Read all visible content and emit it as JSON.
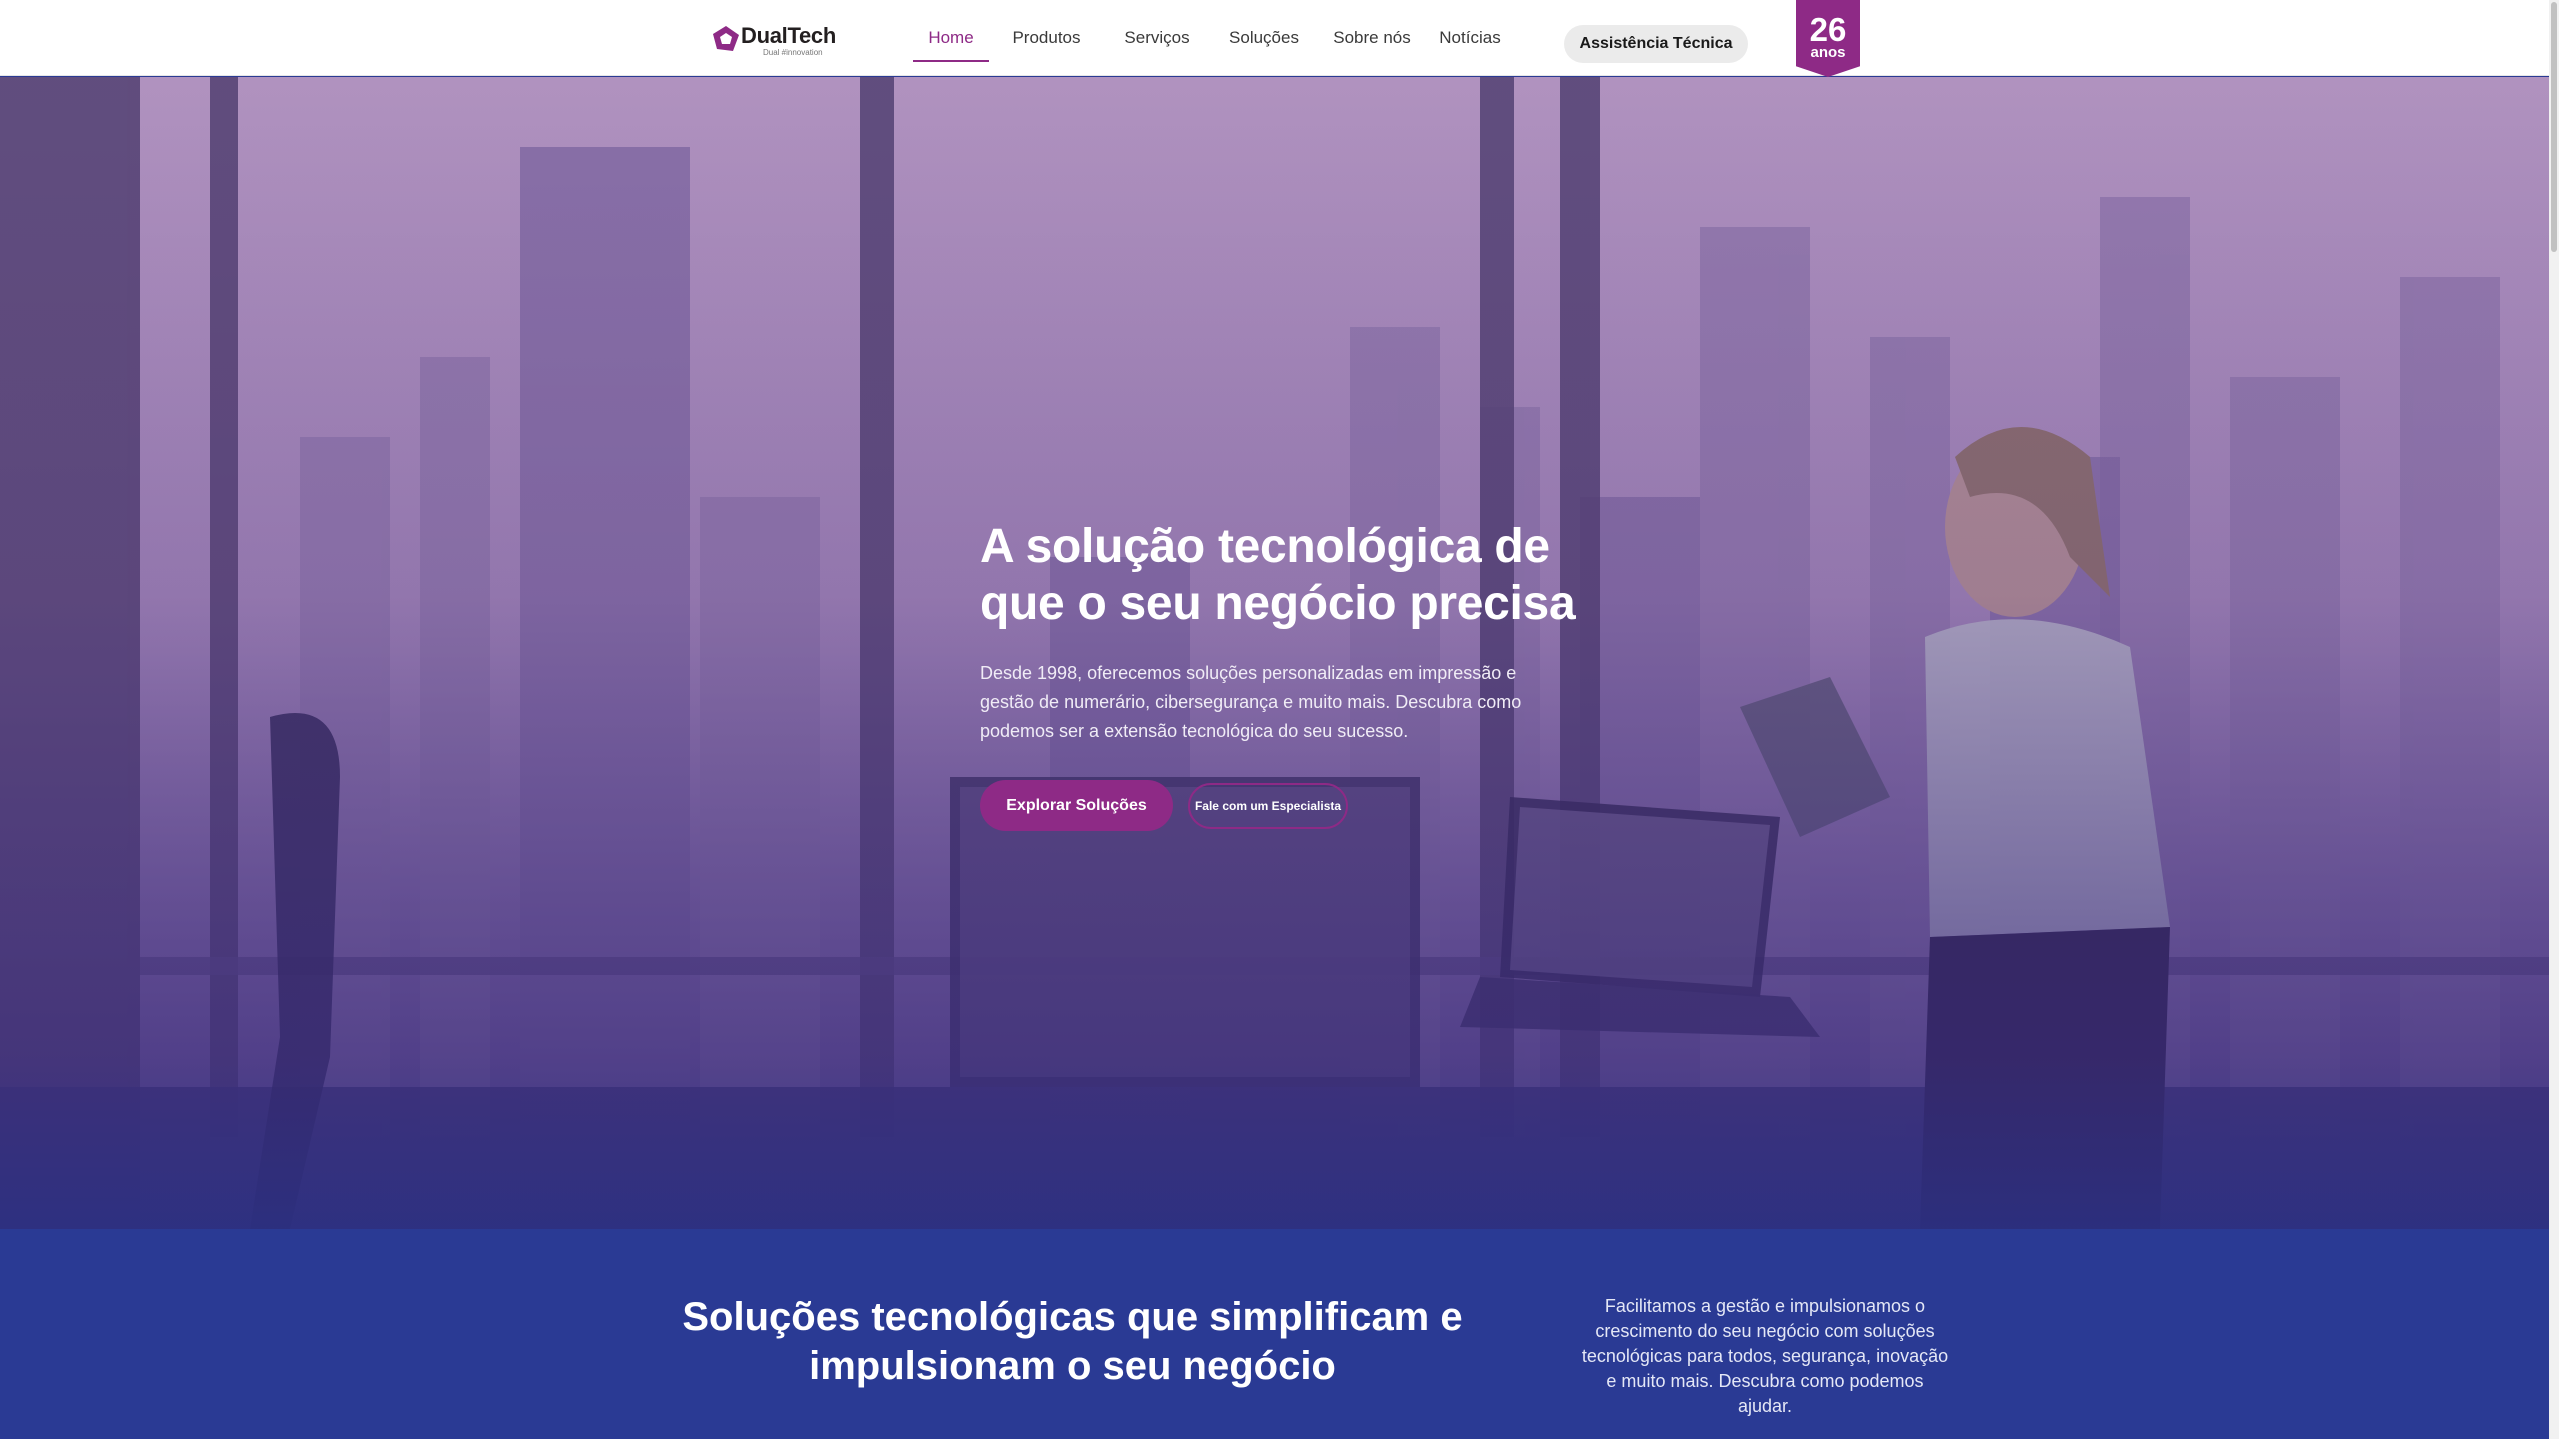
{
  "header": {
    "logo": {
      "name": "DualTech",
      "tagline": "Dual #innovation"
    },
    "nav": [
      {
        "label": "Home",
        "active": true
      },
      {
        "label": "Produtos",
        "active": false
      },
      {
        "label": "Serviços",
        "active": false
      },
      {
        "label": "Soluções",
        "active": false
      },
      {
        "label": "Sobre nós",
        "active": false
      },
      {
        "label": "Notícias",
        "active": false
      }
    ],
    "assist_button": "Assistência Técnica",
    "anniversary": {
      "number": "26",
      "word": "anos"
    }
  },
  "hero": {
    "title": "A solução tecnológica de que o seu negócio precisa",
    "description": "Desde 1998, oferecemos soluções personalizadas em impressão e gestão de numerário, cibersegurança e muito mais. Descubra como podemos ser a extensão tecnológica do seu sucesso.",
    "primary_button": "Explorar Soluções",
    "secondary_button": "Fale com um Especialista"
  },
  "solutions": {
    "title": "Soluções tecnológicas que simplificam e impulsionam o seu negócio",
    "description": "Facilitamos a gestão e impulsionamos o crescimento do seu negócio com soluções tecnológicas para todos, segurança, inovação e muito mais. Descubra como podemos ajudar."
  },
  "colors": {
    "brand": "#8e2a86",
    "band_blue": "#2a3a94",
    "header_bg": "#ffffff"
  }
}
